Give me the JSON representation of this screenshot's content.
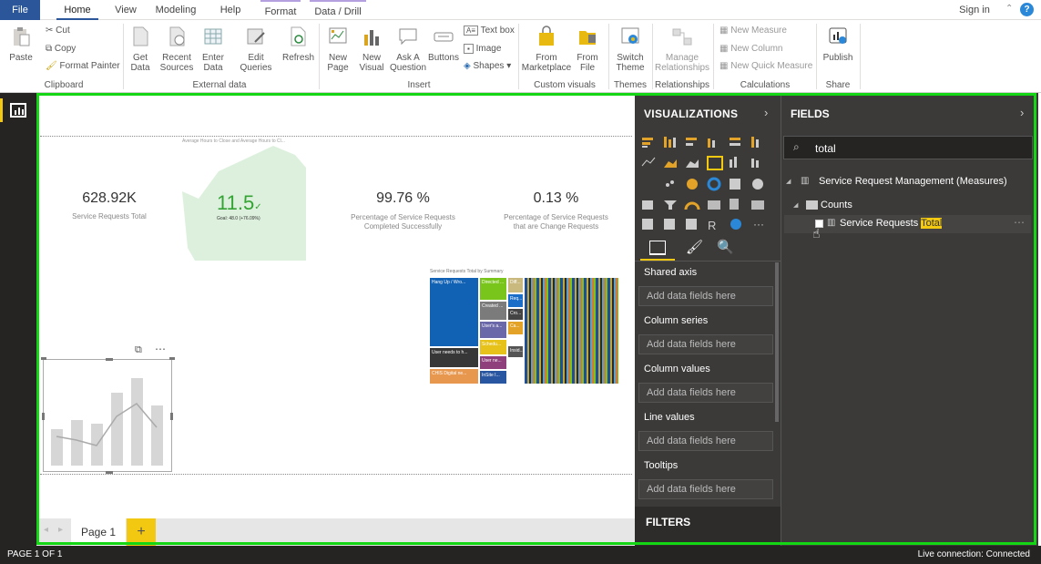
{
  "tabs": [
    {
      "label": "File"
    },
    {
      "label": "Home"
    },
    {
      "label": "View"
    },
    {
      "label": "Modeling"
    },
    {
      "label": "Help"
    },
    {
      "label": "Format"
    },
    {
      "label": "Data / Drill"
    }
  ],
  "signin": "Sign in",
  "ribbon": {
    "clipboard": {
      "paste": "Paste",
      "cut": "Cut",
      "copy": "Copy",
      "format_painter": "Format Painter",
      "group": "Clipboard"
    },
    "external": {
      "get_data": "Get Data",
      "recent_sources": "Recent Sources",
      "enter_data": "Enter Data",
      "edit_queries": "Edit Queries",
      "refresh": "Refresh",
      "group": "External data"
    },
    "insert": {
      "new_page": "New Page",
      "new_visual": "New Visual",
      "ask": "Ask A Question",
      "buttons": "Buttons",
      "text_box": "Text box",
      "image": "Image",
      "shapes": "Shapes",
      "group": "Insert"
    },
    "custom": {
      "from_marketplace": "From Marketplace",
      "from_file": "From File",
      "group": "Custom visuals"
    },
    "themes": {
      "switch_theme": "Switch Theme",
      "group": "Themes"
    },
    "relationships": {
      "manage": "Manage Relationships",
      "group": "Relationships"
    },
    "calculations": {
      "new_measure": "New Measure",
      "new_column": "New Column",
      "new_quick_measure": "New Quick Measure",
      "group": "Calculations"
    },
    "share": {
      "publish": "Publish",
      "group": "Share"
    }
  },
  "canvas": {
    "kpi_title": "Average Hours to Close and Average Hours to Cl...",
    "card1": {
      "value": "628.92K",
      "label": "Service Requests Total"
    },
    "kpi": {
      "value": "11.5",
      "goal": "Goal: 48.0 (+76.09%)"
    },
    "card3": {
      "value": "99.76 %",
      "label": "Percentage of Service Requests Completed Successfully"
    },
    "card4": {
      "value": "0.13 %",
      "label": "Percentage of Service Requests that are Change Requests"
    },
    "treemap": {
      "title": "Service Requests Total by Summary",
      "cells": [
        "Hang Up / Wro...",
        "Directed ...",
        "Diff...",
        "Req...",
        "Created ...",
        "Cro...",
        "User's a...",
        "Ca...",
        "Schedu...",
        "Insid...",
        "User needs to h...",
        "User ne...",
        "CHIS Digital ne...",
        "InSite I..."
      ]
    },
    "page_tab": "Page 1",
    "add_page": "+"
  },
  "viz": {
    "title": "VISUALIZATIONS",
    "wells": [
      {
        "label": "Shared axis",
        "placeholder": "Add data fields here"
      },
      {
        "label": "Column series",
        "placeholder": "Add data fields here"
      },
      {
        "label": "Column values",
        "placeholder": "Add data fields here"
      },
      {
        "label": "Line values",
        "placeholder": "Add data fields here"
      },
      {
        "label": "Tooltips",
        "placeholder": "Add data fields here"
      }
    ],
    "filters": "FILTERS"
  },
  "fields": {
    "title": "FIELDS",
    "search": "total",
    "table": "Service Request Management (Measures)",
    "folder": "Counts",
    "field_prefix": "Service Requests ",
    "field_highlight": "Total"
  },
  "status": {
    "page": "PAGE 1 OF 1",
    "connection": "Live connection: Connected"
  },
  "colors": {
    "accent": "#f2c811",
    "outline": "#15d615",
    "panel": "#3b3a39"
  }
}
